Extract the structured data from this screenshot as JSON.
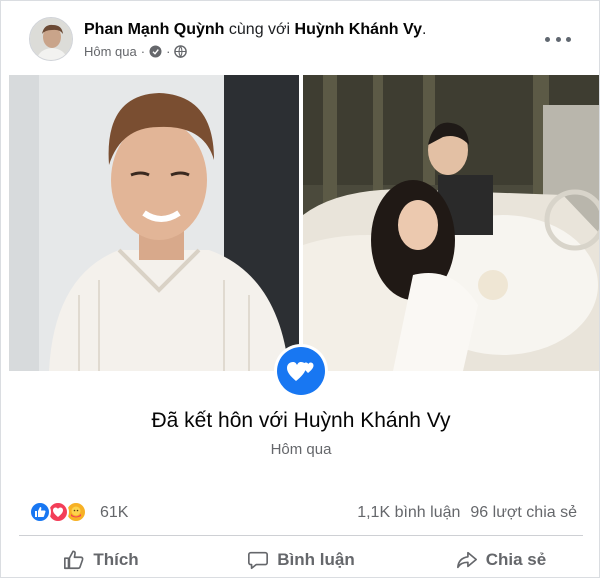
{
  "post": {
    "author": "Phan Mạnh Quỳnh",
    "with_text": "cùng với",
    "tagged": "Huỳnh Khánh Vy",
    "time": "Hôm qua",
    "separator": "·",
    "privacy_icon": "globe-icon"
  },
  "life_event": {
    "icon": "hearts-icon",
    "title": "Đã kết hôn với Huỳnh Khánh Vy",
    "date": "Hôm qua"
  },
  "stats": {
    "reaction_icons": [
      "like-icon",
      "love-icon",
      "care-icon"
    ],
    "reactions_count": "61K",
    "comments": "1,1K bình luận",
    "shares": "96 lượt chia sẻ"
  },
  "actions": {
    "like": "Thích",
    "comment": "Bình luận",
    "share": "Chia sẻ"
  },
  "colors": {
    "accent": "#1877f2",
    "love": "#f33e58",
    "care": "#f7b125",
    "muted_text": "#65676b"
  }
}
